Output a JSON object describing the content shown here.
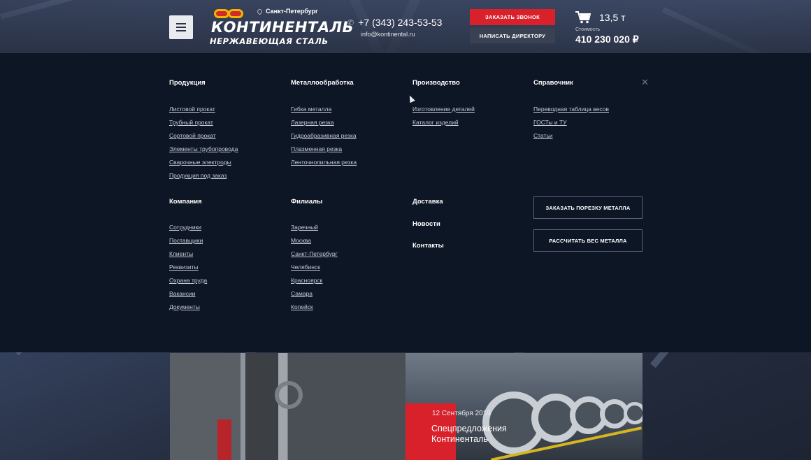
{
  "header": {
    "city": "Санкт-Петербург",
    "logo_name": "КОНТИНЕНТАЛЬ",
    "logo_sub": "НЕРЖАВЕЮЩАЯ СТАЛЬ",
    "phone": "+7 (343) 243-53-53",
    "email": "info@kontinental.ru",
    "call_button": "ЗАКАЗАТЬ ЗВОНОК",
    "director_button": "НАПИСАТЬ ДИРЕКТОРУ",
    "cart": {
      "weight": "13,5 т",
      "cost_label": "Стоимость",
      "cost": "410 230 020 ₽"
    }
  },
  "menu": {
    "products": {
      "title": "Продукция",
      "items": [
        "Листовой прокат",
        "Трубный прокат",
        "Сортовой прокат",
        "Элементы трубопровода",
        "Сварочные электроды",
        "Продукция под заказ"
      ]
    },
    "metalworking": {
      "title": "Металлообработка",
      "items": [
        "Гибка металла",
        "Лазерная резка",
        "Гидроабразивная резка",
        "Плазменная резка",
        "Ленточнопильная резка"
      ]
    },
    "production": {
      "title": "Производство",
      "items": [
        "Изготовление деталей",
        "Каталог изделий"
      ]
    },
    "reference": {
      "title": "Справочник",
      "items": [
        "Переводная таблица весов",
        "ГОСТы и ТУ",
        "Статьи"
      ]
    },
    "company": {
      "title": "Компания",
      "items": [
        "Сотрудники",
        "Поставщики",
        "Клиенты",
        "Реквизиты",
        "Охрана труда",
        "Вакансии",
        "Документы"
      ]
    },
    "branches": {
      "title": "Филиалы",
      "items": [
        "Заречный",
        "Москва",
        "Санкт-Петербург",
        "Челябинск",
        "Красноярск",
        "Самара",
        "Копейск"
      ]
    },
    "delivery": "Доставка",
    "news": "Новости",
    "contacts": "Контакты",
    "cut_button": "ЗАКАЗАТЬ ПОРЕЗКУ МЕТАЛЛА",
    "weight_button": "РАССЧИТАТЬ ВЕС МЕТАЛЛА"
  },
  "promo": {
    "date": "12 Сентября 2019",
    "title_line1": "Спецпредложения",
    "title_line2": "Континенталь"
  },
  "colors": {
    "accent": "#d9212c",
    "overlay": "#0d1624"
  },
  "icons": [
    "menu-icon",
    "location-pin-icon",
    "phone-icon",
    "cart-icon",
    "close-icon"
  ]
}
